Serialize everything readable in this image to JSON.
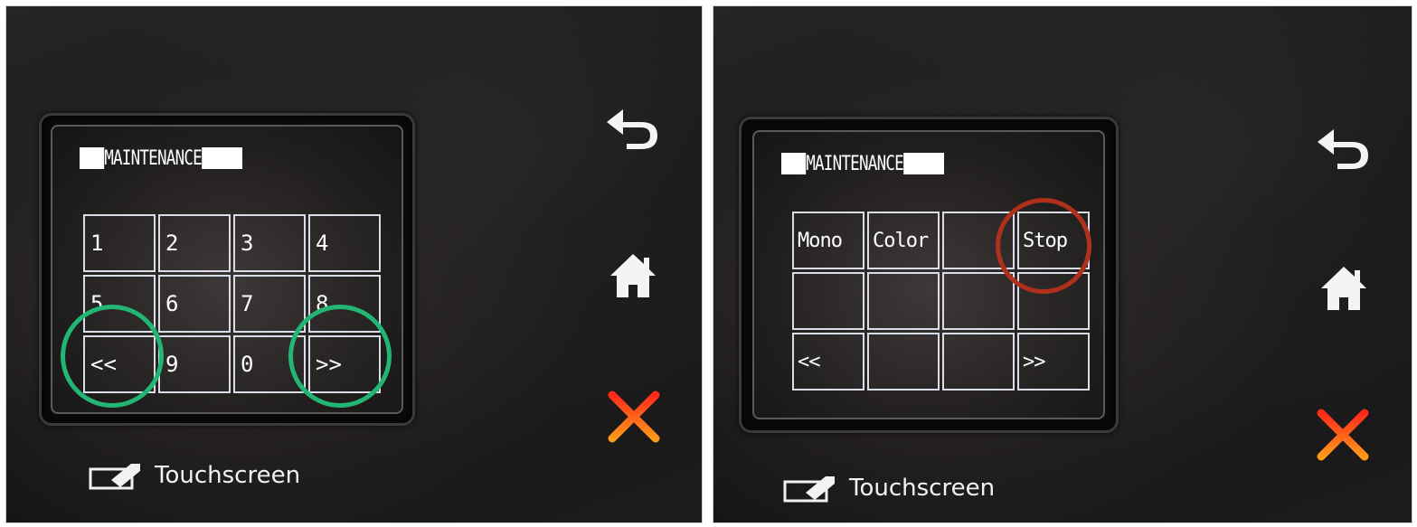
{
  "panels": [
    {
      "title": "MAINTENANCE",
      "keys": [
        "1",
        "2",
        "3",
        "4",
        "5",
        "6",
        "7",
        "8",
        "<<",
        "9",
        "0",
        ">>"
      ],
      "touch_label": "Touchscreen"
    },
    {
      "title": "MAINTENANCE",
      "keys": [
        "Mono",
        "Color",
        "",
        "Stop",
        "",
        "",
        "",
        "",
        "<<",
        "",
        "",
        ">>"
      ],
      "touch_label": "Touchscreen"
    }
  ],
  "icons": {
    "back": "back-arrow-icon",
    "home": "home-icon",
    "cancel": "cancel-x-icon",
    "touchscreen": "touchscreen-icon"
  },
  "colors": {
    "highlight_green": "#22b573",
    "highlight_red": "#b0301c",
    "cancel_red": "#ff2a1a",
    "cancel_orange": "#ff9a1a"
  }
}
